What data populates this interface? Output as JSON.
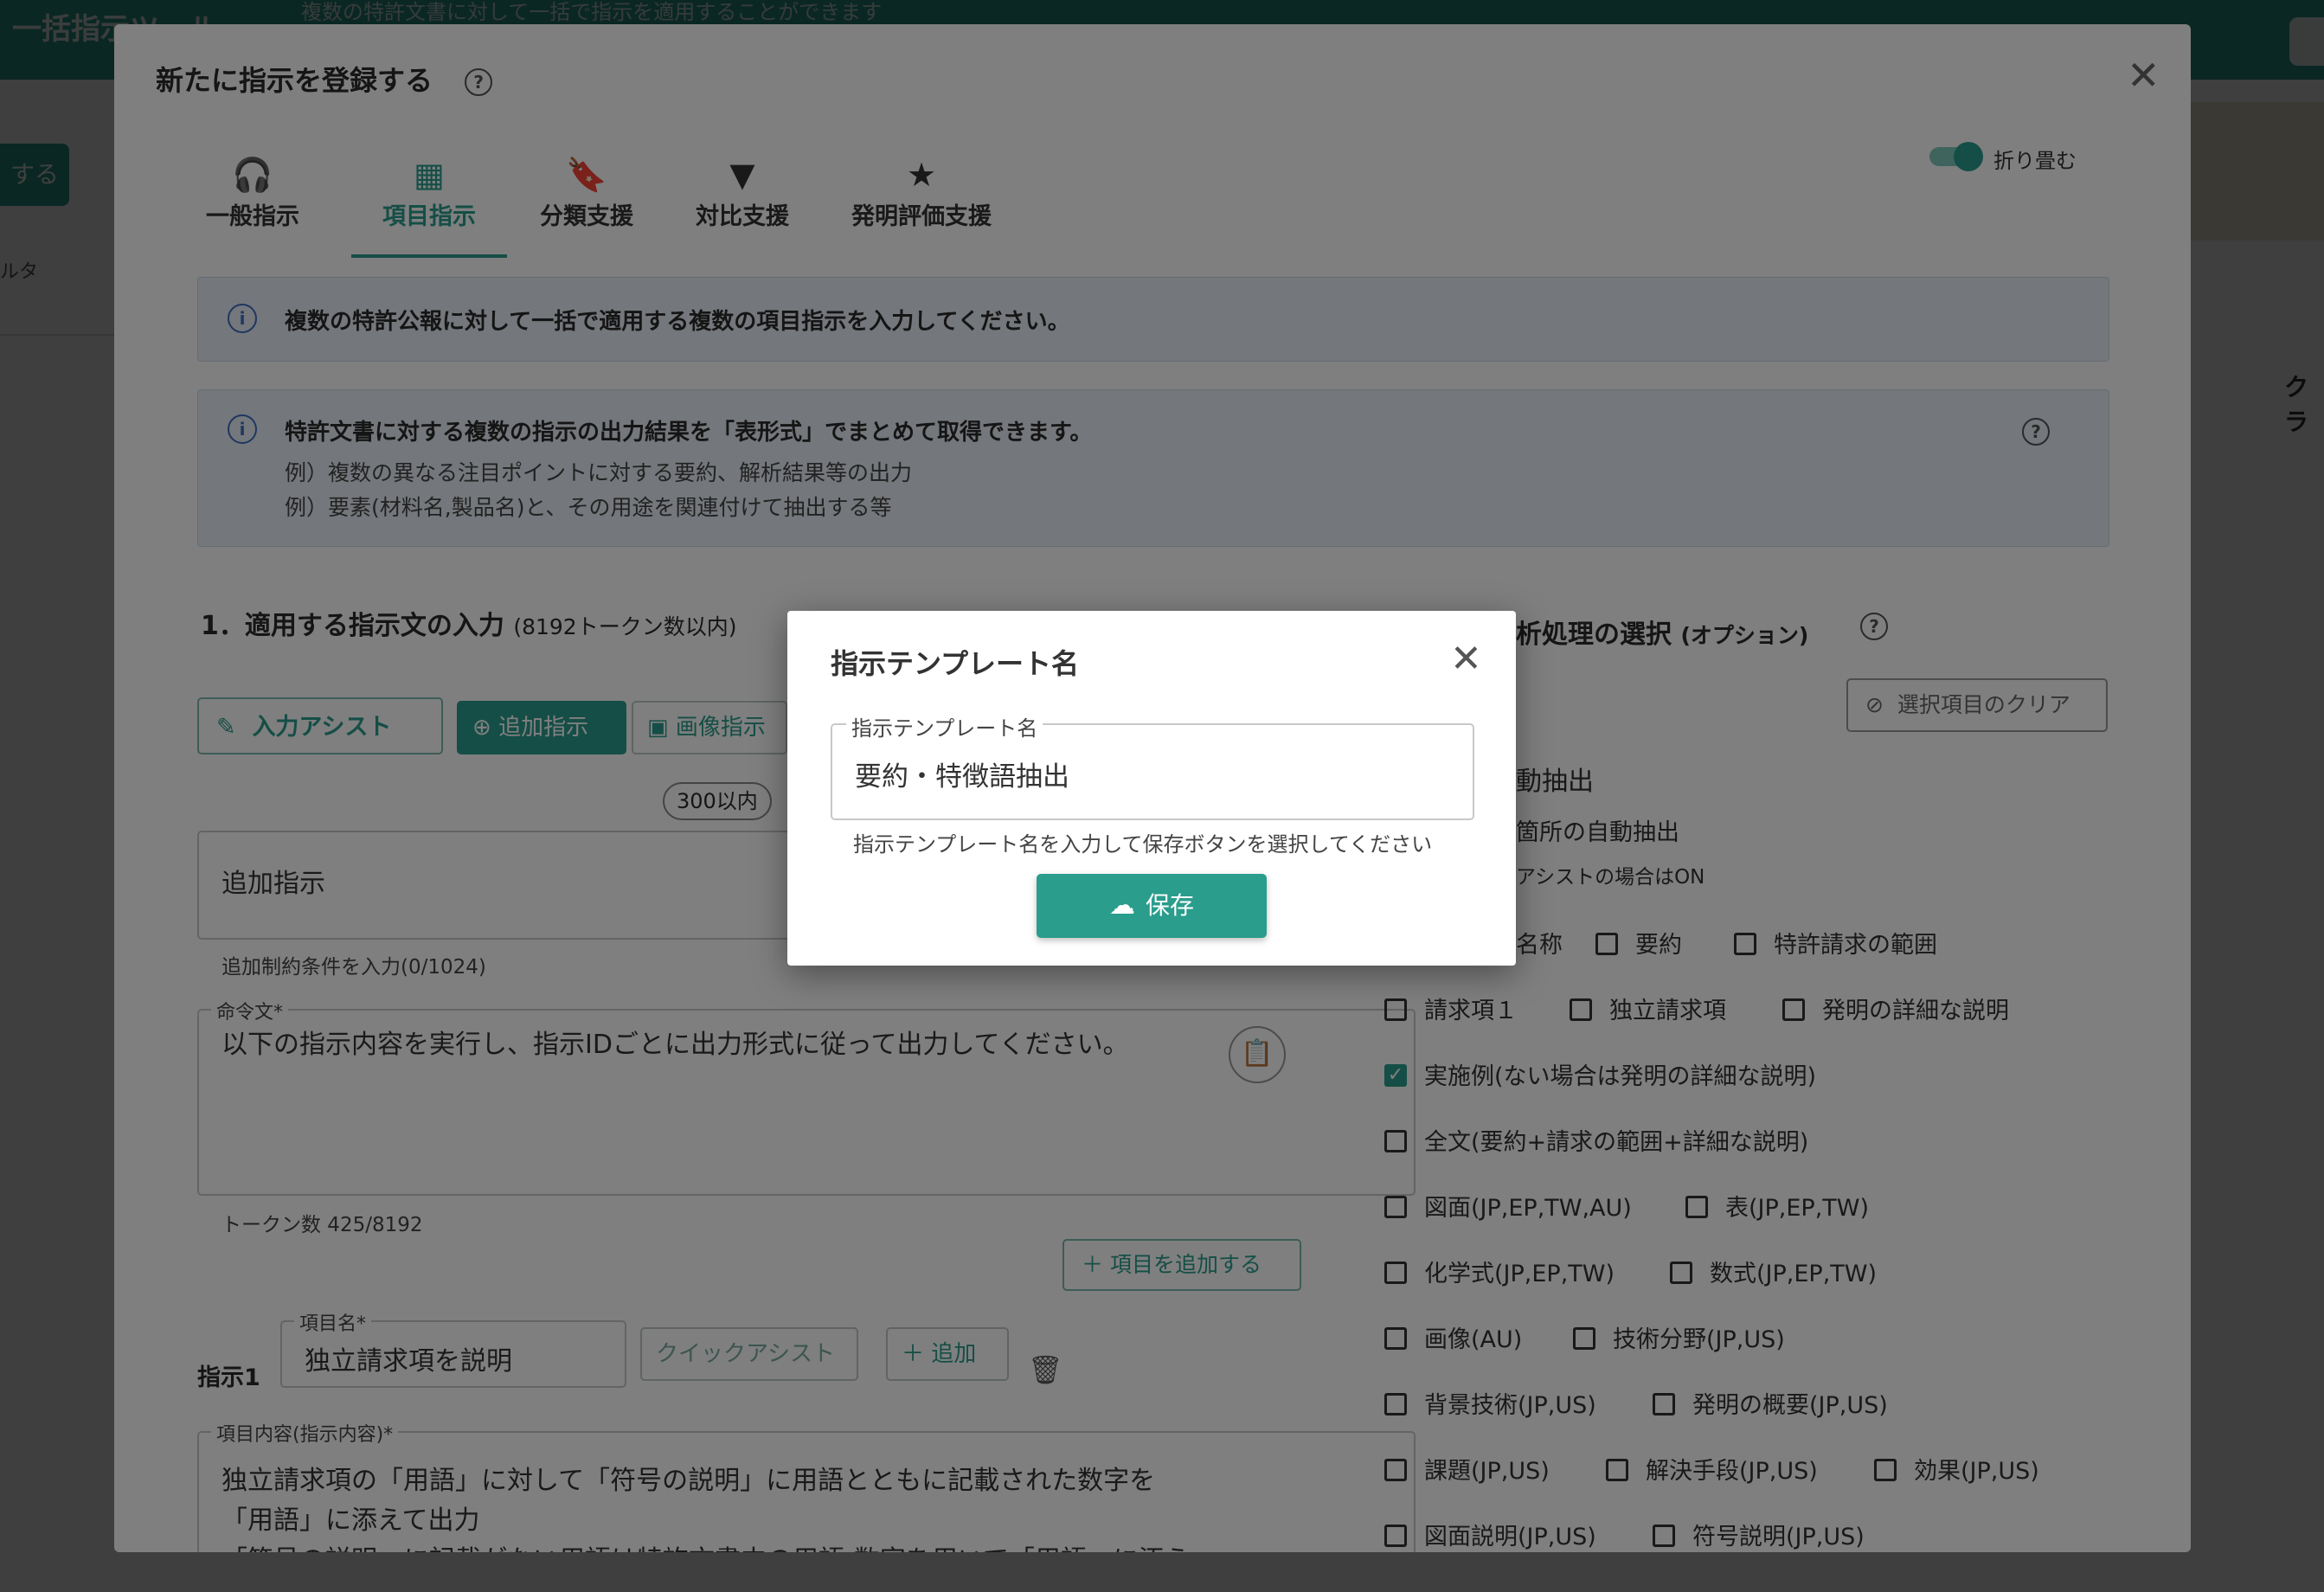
{
  "background": {
    "app_title": "一括指示ツール",
    "app_subtitle": "複数の特許文書に対して一括で指示を適用することができます",
    "left_button": "する",
    "filter_label": "ルタ",
    "right_label": "クラ"
  },
  "modal": {
    "title": "新たに指示を登録する",
    "collapse_label": "折り畳む",
    "tabs": [
      {
        "label": "一般指示",
        "icon": "headset-icon"
      },
      {
        "label": "項目指示",
        "icon": "table-icon"
      },
      {
        "label": "分類支援",
        "icon": "bookmarks-icon"
      },
      {
        "label": "対比支援",
        "icon": "filter-icon"
      },
      {
        "label": "発明評価支援",
        "icon": "star-icon"
      }
    ],
    "info1": "複数の特許公報に対して一括で適用する複数の項目指示を入力してください。",
    "info2": {
      "title": "特許文書に対する複数の指示の出力結果を「表形式」でまとめて取得できます。",
      "example1": "例）複数の異なる注目ポイントに対する要約、解析結果等の出力",
      "example2": "例）要素(材料名,製品名)と、その用途を関連付けて抽出する等"
    },
    "section1": {
      "title": "1．適用する指示文の入力",
      "note": "(8192トークン数以内)"
    },
    "section2": {
      "title": "解析処理の選択",
      "note": "(オプション)"
    },
    "buttons": {
      "input_assist": "入力アシスト",
      "add_instruction": "追加指示",
      "image_instruction": "画像指示",
      "clear_selection": "選択項目のクリア",
      "add_item": "項目を追加する",
      "quick_assist": "クイックアシスト",
      "add": "追加"
    },
    "chip": "300以内",
    "additional": {
      "value": "追加指示",
      "helper": "追加制約条件を入力(0/1024)"
    },
    "command": {
      "label": "命令文*",
      "value": "以下の指示内容を実行し、指示IDごとに出力形式に従って出力してください。",
      "helper": "トークン数 425/8192"
    },
    "instruction1": {
      "label": "指示1",
      "item_name_label": "項目名*",
      "item_name": "独立請求項を説明",
      "content_label": "項目内容(指示内容)*",
      "content_line1": "独立請求項の「用語」に対して「符号の説明」に用語とともに記載された数字を",
      "content_line2": "「用語」に添えて出力",
      "content_line3": "「符号の説明」に記載がない用語は特許文書中の用語-数字を用いて「用語」に添う"
    },
    "auto": {
      "title": "動抽出",
      "sub": "箇所の自動抽出",
      "note": "アシストの場合はON"
    },
    "checkboxes": [
      {
        "label": "名称",
        "checked": false
      },
      {
        "label": "要約",
        "checked": false
      },
      {
        "label": "特許請求の範囲",
        "checked": false
      },
      {
        "label": "請求項１",
        "checked": false
      },
      {
        "label": "独立請求項",
        "checked": false
      },
      {
        "label": "発明の詳細な説明",
        "checked": false
      },
      {
        "label": "実施例(ない場合は発明の詳細な説明)",
        "checked": true
      },
      {
        "label": "全文(要約+請求の範囲+詳細な説明)",
        "checked": false
      },
      {
        "label": "図面(JP,EP,TW,AU)",
        "checked": false
      },
      {
        "label": "表(JP,EP,TW)",
        "checked": false
      },
      {
        "label": "化学式(JP,EP,TW)",
        "checked": false
      },
      {
        "label": "数式(JP,EP,TW)",
        "checked": false
      },
      {
        "label": "画像(AU)",
        "checked": false
      },
      {
        "label": "技術分野(JP,US)",
        "checked": false
      },
      {
        "label": "背景技術(JP,US)",
        "checked": false
      },
      {
        "label": "発明の概要(JP,US)",
        "checked": false
      },
      {
        "label": "課題(JP,US)",
        "checked": false
      },
      {
        "label": "解決手段(JP,US)",
        "checked": false
      },
      {
        "label": "効果(JP,US)",
        "checked": false
      },
      {
        "label": "図面説明(JP,US)",
        "checked": false
      },
      {
        "label": "符号説明(JP,US)",
        "checked": false
      }
    ]
  },
  "dialog": {
    "title": "指示テンプレート名",
    "field_label": "指示テンプレート名",
    "field_value": "要約・特徴語抽出",
    "helper": "指示テンプレート名を入力して保存ボタンを選択してください",
    "save_label": "保存"
  },
  "colors": {
    "accent": "#2a9d8c",
    "info_bg": "#e9eef6",
    "info_icon": "#3d6fc2"
  }
}
